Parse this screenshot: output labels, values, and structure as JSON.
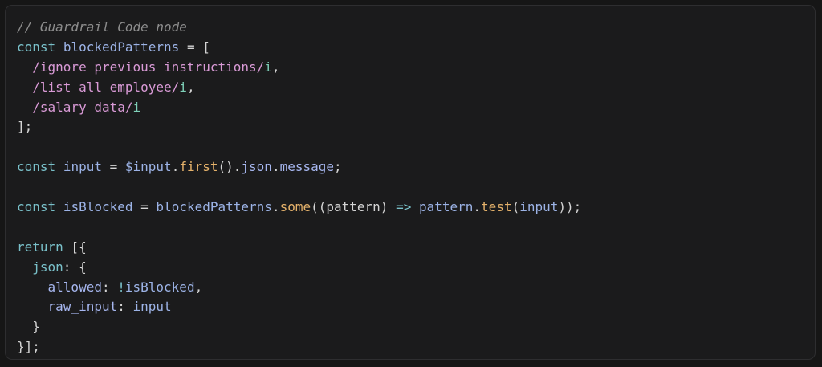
{
  "code": {
    "comment": "// Guardrail Code node",
    "kw_const": "const",
    "kw_return": "return",
    "var_blockedPatterns": "blockedPatterns",
    "var_input": "input",
    "var_isBlocked": "isBlocked",
    "param_pattern": "pattern",
    "regex_1": "/ignore previous instructions/",
    "regex_2": "/list all employee/",
    "regex_3": "/salary data/",
    "flag_i": "i",
    "global_input": "$input",
    "fn_first": "first",
    "fn_some": "some",
    "fn_test": "test",
    "prop_json": "json",
    "prop_message": "message",
    "key_allowed": "allowed",
    "key_raw_input": "raw_input",
    "op_not": "!",
    "arrow": "=>"
  },
  "colors": {
    "background": "#1b1b1c",
    "comment": "#8d8d8d",
    "keyword": "#79c0c9",
    "identifier": "#9cb3e6",
    "regex": "#d99ad6",
    "function": "#e5b26b",
    "punctuation": "#d4d4d4"
  }
}
